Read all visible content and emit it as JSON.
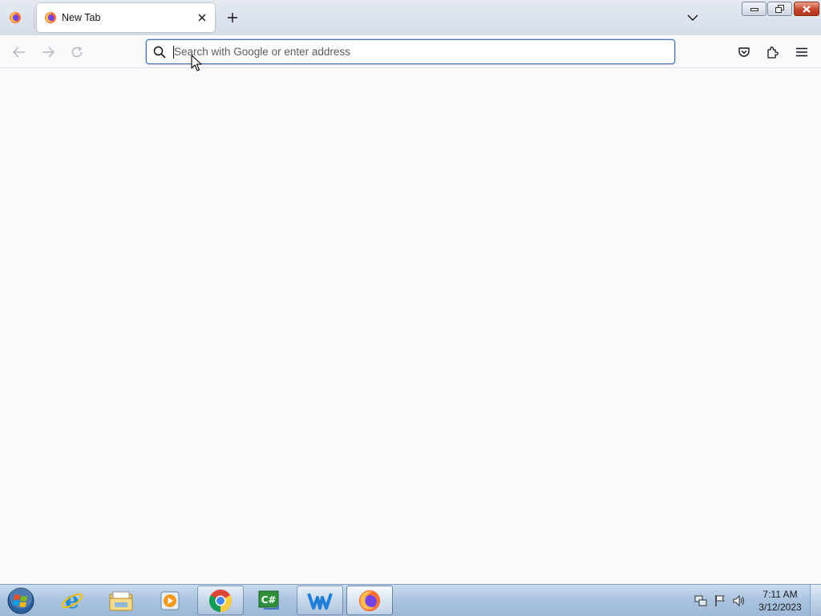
{
  "tab": {
    "title": "New Tab"
  },
  "urlbar": {
    "placeholder": "Search with Google or enter address"
  },
  "taskbar": {
    "apps": [
      "Internet Explorer",
      "Windows Explorer",
      "Windows Media Player",
      "Google Chrome",
      "C# Editor",
      "WPS Writer",
      "Firefox"
    ],
    "clock": {
      "time": "7:11 AM",
      "date": "3/12/2023"
    }
  },
  "colors": {
    "accent": "#4a75b4",
    "content_bg": "#f9f9fb"
  }
}
